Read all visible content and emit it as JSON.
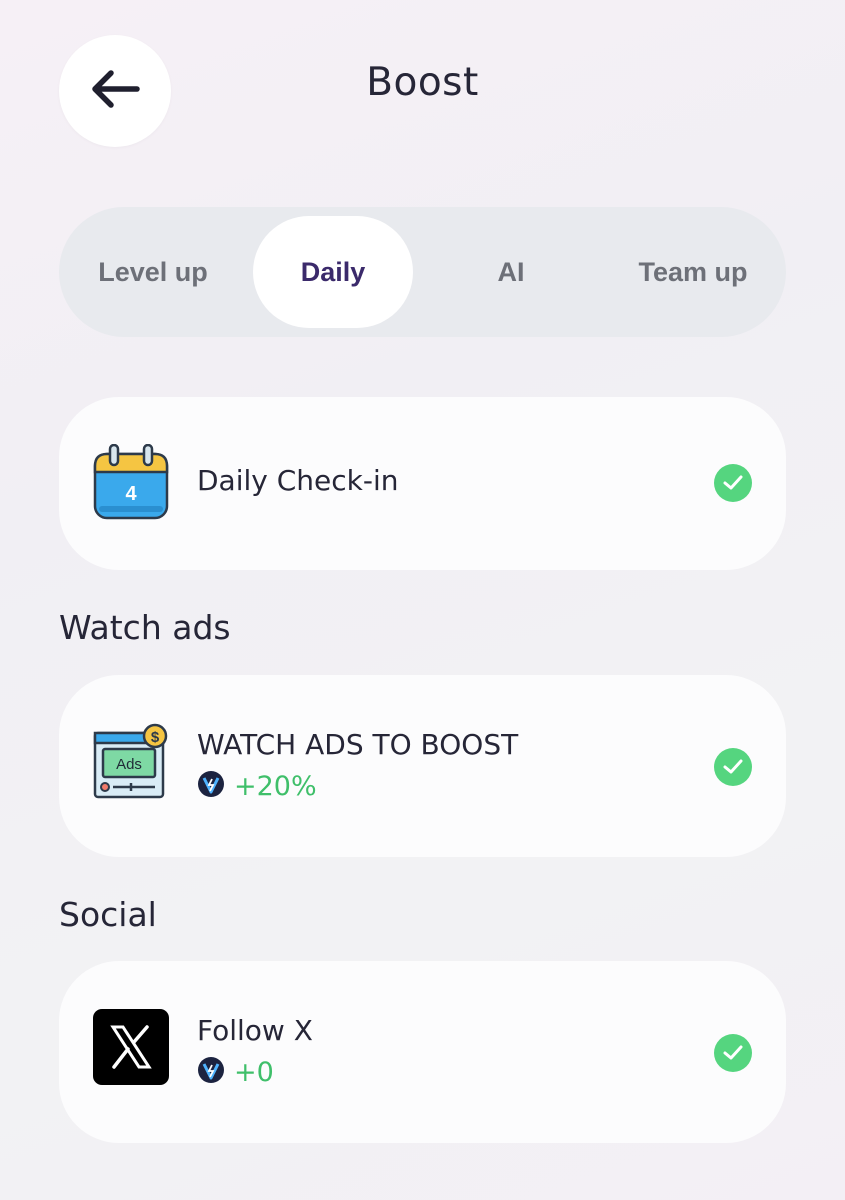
{
  "header": {
    "title": "Boost",
    "back_icon": "arrow-left-icon"
  },
  "tabs": [
    {
      "label": "Level up",
      "active": false
    },
    {
      "label": "Daily",
      "active": true
    },
    {
      "label": "AI",
      "active": false
    },
    {
      "label": "Team up",
      "active": false
    }
  ],
  "daily_checkin": {
    "title": "Daily Check-in",
    "icon": "calendar-icon",
    "calendar_day": "4",
    "completed": true
  },
  "watch_ads": {
    "section_title": "Watch ads",
    "task": {
      "title": "WATCH ADS TO BOOST",
      "icon": "ads-screen-icon",
      "icon_label": "Ads",
      "reward": "+20%",
      "completed": true
    }
  },
  "social": {
    "section_title": "Social",
    "task": {
      "title": "Follow X",
      "icon": "x-logo-icon",
      "reward": "+0",
      "completed": true
    }
  },
  "colors": {
    "active_tab_text": "#3b2a6b",
    "inactive_tab_text": "#6d7078",
    "reward_green": "#3fbf6a",
    "check_green": "#55d57f"
  }
}
